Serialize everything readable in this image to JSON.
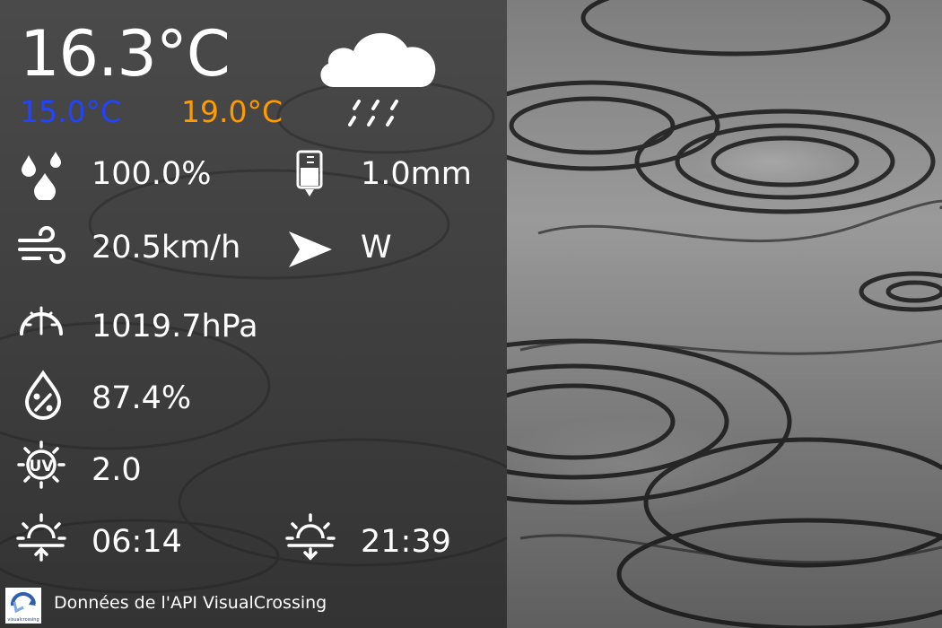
{
  "weather": {
    "temperature": "16.3°C",
    "temp_min": "15.0°C",
    "temp_max": "19.0°C",
    "condition_icon": "cloud-rain-icon",
    "precip_probability": "100.0%",
    "precip_amount": "1.0mm",
    "wind_speed": "20.5km/h",
    "wind_direction": "W",
    "pressure": "1019.7hPa",
    "humidity": "87.4%",
    "uv_index": "2.0",
    "sunrise": "06:14",
    "sunset": "21:39"
  },
  "footer": {
    "attribution": "Données de l'API VisualCrossing",
    "logo_text": "visualcrossing"
  },
  "colors": {
    "temp_min": "#2244ff",
    "temp_max": "#ff9a00",
    "panel": "#404040",
    "text": "#ffffff"
  }
}
